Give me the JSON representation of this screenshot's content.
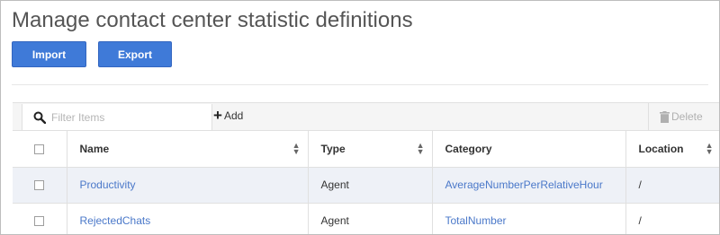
{
  "page": {
    "title": "Manage contact center statistic definitions"
  },
  "actions": {
    "import_label": "Import",
    "export_label": "Export"
  },
  "toolbar": {
    "search_placeholder": "Filter Items",
    "add_label": "Add",
    "delete_label": "Delete"
  },
  "table": {
    "columns": [
      "Name",
      "Type",
      "Category",
      "Location"
    ],
    "rows": [
      {
        "name": "Productivity",
        "type": "Agent",
        "category": "AverageNumberPerRelativeHour",
        "location": "/"
      },
      {
        "name": "RejectedChats",
        "type": "Agent",
        "category": "TotalNumber",
        "location": "/"
      }
    ]
  },
  "colors": {
    "button": "#3f7ad8",
    "link": "#4a78c9",
    "row_highlight": "#eef1f7"
  }
}
